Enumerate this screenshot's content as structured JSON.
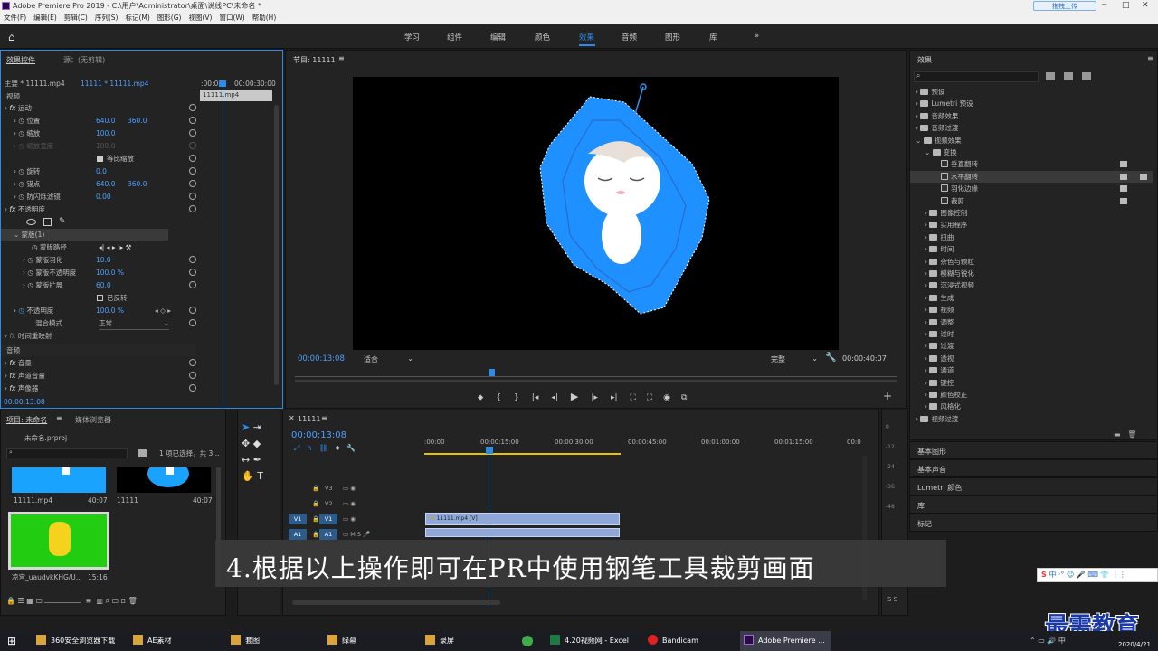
{
  "titlebar": {
    "title": "Adobe Premiere Pro 2019 - C:\\用户\\Administrator\\桌面\\说线PC\\未命名 *",
    "upload_label": "拖拽上传"
  },
  "menu": [
    "文件(F)",
    "编辑(E)",
    "剪辑(C)",
    "序列(S)",
    "标记(M)",
    "图形(G)",
    "视图(V)",
    "窗口(W)",
    "帮助(H)"
  ],
  "workspaces": [
    "学习",
    "组件",
    "编辑",
    "颜色",
    "效果",
    "音频",
    "图形",
    "库"
  ],
  "effect_controls": {
    "tab": "效果控件",
    "tab2": "源：(无剪辑)",
    "master": "主要 * 11111.mp4",
    "seq": "11111 * 11111.mp4",
    "tc_left": ":00:00",
    "tc_right": "00:00:30:00",
    "clip_bar": "11111.mp4",
    "section_video": "视频",
    "rows": [
      {
        "label": "运动",
        "v1": "",
        "v2": ""
      },
      {
        "label": "位置",
        "v1": "640.0",
        "v2": "360.0"
      },
      {
        "label": "缩放",
        "v1": "100.0",
        "v2": ""
      },
      {
        "label": "缩放宽度",
        "v1": "100.0",
        "v2": ""
      },
      {
        "label": "等比缩放",
        "v1": "",
        "v2": ""
      },
      {
        "label": "旋转",
        "v1": "0.0",
        "v2": ""
      },
      {
        "label": "锚点",
        "v1": "640.0",
        "v2": "360.0"
      },
      {
        "label": "防闪烁滤镜",
        "v1": "0.00",
        "v2": ""
      },
      {
        "label": "不透明度",
        "v1": "",
        "v2": ""
      },
      {
        "label": "",
        "v1": "",
        "v2": ""
      },
      {
        "label": "蒙版(1)",
        "v1": "",
        "v2": ""
      },
      {
        "label": "蒙版路径",
        "v1": "",
        "v2": ""
      },
      {
        "label": "蒙版羽化",
        "v1": "10.0",
        "v2": ""
      },
      {
        "label": "蒙版不透明度",
        "v1": "100.0 %",
        "v2": ""
      },
      {
        "label": "蒙版扩展",
        "v1": "60.0",
        "v2": ""
      },
      {
        "label": "已反转",
        "v1": "",
        "v2": ""
      },
      {
        "label": "不透明度",
        "v1": "100.0 %",
        "v2": ""
      },
      {
        "label": "混合模式",
        "v1": "正常",
        "v2": ""
      },
      {
        "label": "时间重映射",
        "v1": "",
        "v2": ""
      }
    ],
    "section_audio": "音频",
    "audio_rows": [
      "音量",
      "声道音量",
      "声像器"
    ],
    "timecode": "00:00:13:08"
  },
  "program": {
    "title": "节目: 11111",
    "timecode": "00:00:13:08",
    "fit": "适合",
    "quality": "完整",
    "duration": "00:00:40:07"
  },
  "effects": {
    "title": "效果",
    "items": [
      {
        "label": "预设",
        "indent": 0
      },
      {
        "label": "Lumetri 预设",
        "indent": 0
      },
      {
        "label": "音频效果",
        "indent": 0
      },
      {
        "label": "音频过渡",
        "indent": 0
      },
      {
        "label": "视频效果",
        "indent": 0
      },
      {
        "label": "变换",
        "indent": 1
      },
      {
        "label": "垂直翻转",
        "indent": 2
      },
      {
        "label": "水平翻转",
        "indent": 2
      },
      {
        "label": "羽化边缘",
        "indent": 2
      },
      {
        "label": "裁剪",
        "indent": 2
      },
      {
        "label": "图像控制",
        "indent": 1
      },
      {
        "label": "实用程序",
        "indent": 1
      },
      {
        "label": "扭曲",
        "indent": 1
      },
      {
        "label": "时间",
        "indent": 1
      },
      {
        "label": "杂色与颗粒",
        "indent": 1
      },
      {
        "label": "模糊与锐化",
        "indent": 1
      },
      {
        "label": "沉浸式视频",
        "indent": 1
      },
      {
        "label": "生成",
        "indent": 1
      },
      {
        "label": "视频",
        "indent": 1
      },
      {
        "label": "调整",
        "indent": 1
      },
      {
        "label": "过时",
        "indent": 1
      },
      {
        "label": "过渡",
        "indent": 1
      },
      {
        "label": "透视",
        "indent": 1
      },
      {
        "label": "通道",
        "indent": 1
      },
      {
        "label": "键控",
        "indent": 1
      },
      {
        "label": "颜色校正",
        "indent": 1
      },
      {
        "label": "风格化",
        "indent": 1
      },
      {
        "label": "视频过渡",
        "indent": 0
      }
    ],
    "sections": [
      "基本图形",
      "基本声音",
      "Lumetri 颜色",
      "库",
      "标记"
    ]
  },
  "project": {
    "tab": "项目: 未命名",
    "tab2": "媒体浏览器",
    "file": "未命名.prproj",
    "selection": "1 项已选择，共 3...",
    "clips": [
      {
        "name": "11111.mp4",
        "dur": "40:07"
      },
      {
        "name": "11111",
        "dur": "40:07"
      },
      {
        "name": "凉宫_uaudvkKHG/U...",
        "dur": "15:16"
      }
    ]
  },
  "timeline": {
    "tab": "11111",
    "timecode": "00:00:13:08",
    "ruler": [
      ":00:00",
      "00:00:15:00",
      "00:00:30:00",
      "00:00:45:00",
      "00:01:00:00",
      "00:01:15:00",
      "00:0"
    ],
    "tracks": [
      "V3",
      "V2",
      "V1",
      "A1"
    ],
    "clip": "11111.mp4 [V]"
  },
  "subtitle": "4.根据以上操作即可在PR中使用钢笔工具裁剪画面",
  "watermark": "最需教育",
  "taskbar": {
    "items": [
      "360安全浏览器下载",
      "AE素材",
      "套图",
      "绿幕",
      "录屏",
      "4.20视频网 - Excel",
      "Bandicam",
      "Adobe Premiere ..."
    ],
    "date": "2020/4/21",
    "ime": "中"
  },
  "colors": {
    "accent": "#2d8ceb",
    "mask": "#1e90ff",
    "clip": "#8fa8d8",
    "green": "#22cc11"
  }
}
